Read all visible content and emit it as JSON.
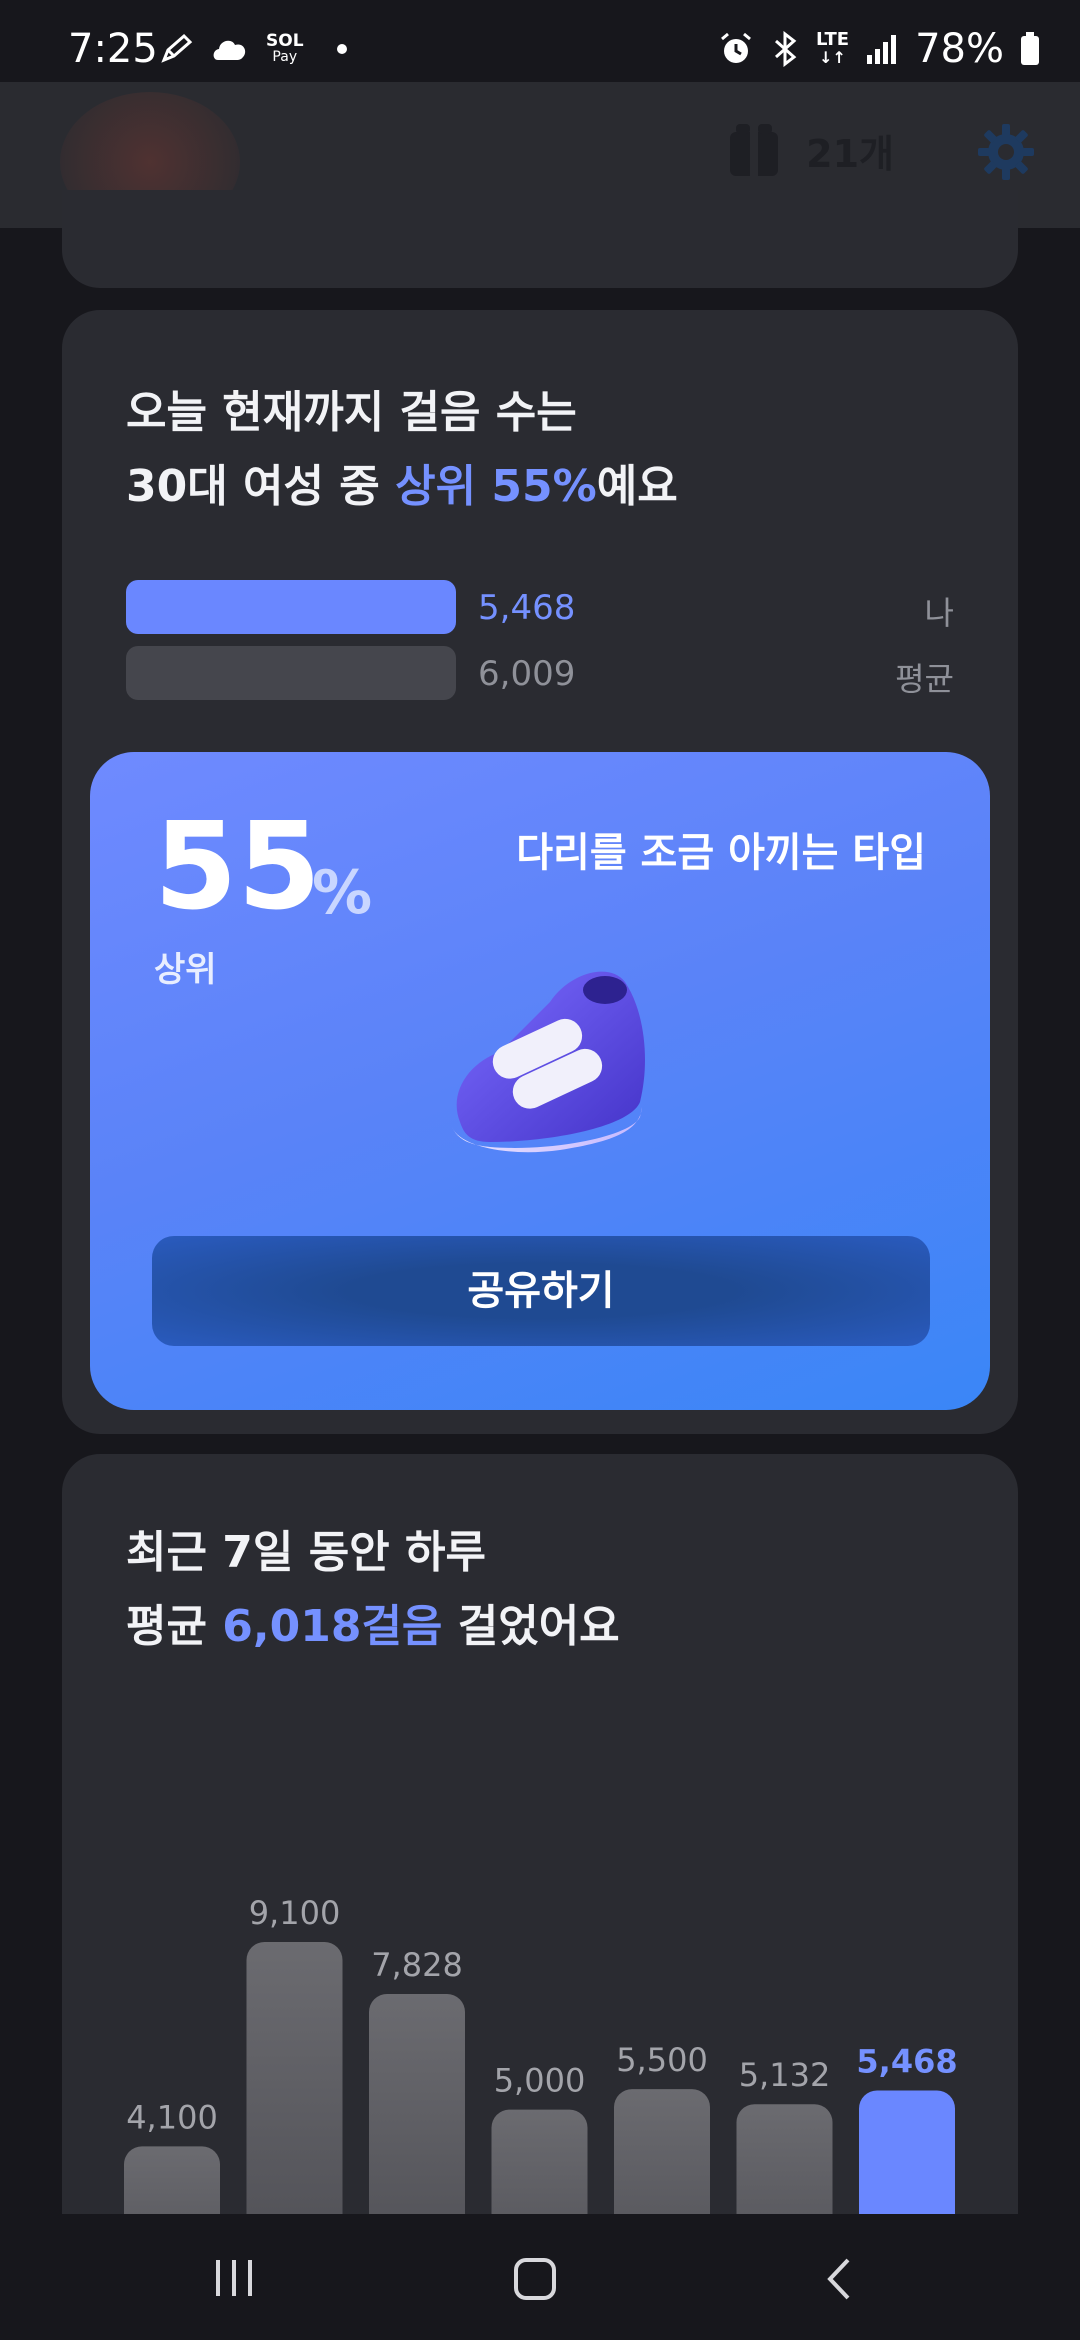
{
  "status_bar": {
    "time": "7:25",
    "left_icons": [
      "pencil-icon",
      "cloud-icon",
      "sol-pay-icon",
      "dot-icon"
    ],
    "sol_pay_top": "SOL",
    "sol_pay_bottom": "Pay",
    "network": "LTE",
    "battery": "78%"
  },
  "header": {
    "gift_count": "21개"
  },
  "card_rank": {
    "headline_line1": "오늘 현재까지 걸음 수는",
    "headline_line2_prefix": "30대 여성 중 ",
    "headline_line2_accent": "상위 55%",
    "headline_line2_suffix": "예요",
    "me": {
      "value": "5,468",
      "label": "나"
    },
    "average": {
      "value": "6,009",
      "label": "평균"
    },
    "result": {
      "number": "55",
      "unit": "%",
      "rank_label": "상위",
      "type_title": "다리를 조금 아끼는 타입",
      "share_label": "공유하기"
    }
  },
  "card_week": {
    "headline_line1": "최근 7일 동안 하루",
    "headline_line2_prefix": "평균 ",
    "headline_line2_accent": "6,018걸음",
    "headline_line2_suffix": " 걸었어요"
  },
  "chart_data": {
    "type": "bar",
    "title": "",
    "values": [
      4100,
      9100,
      7828,
      5000,
      5500,
      5132,
      5468
    ],
    "labels": [
      "4,100",
      "9,100",
      "7,828",
      "5,000",
      "5,500",
      "5,132",
      "5,468"
    ],
    "highlight_index": 6,
    "ylim": [
      0,
      9100
    ],
    "colors": {
      "bar": "#68686d",
      "highlight": "#6a87ff"
    }
  },
  "colors": {
    "accent": "#7591ff",
    "card_bg": "#2a2b31",
    "page_bg": "#17171c",
    "result_gradient_start": "#6f8aff",
    "result_gradient_end": "#3a86f7"
  },
  "nav": {
    "items": [
      "recent-apps-icon",
      "home-icon",
      "back-icon"
    ]
  }
}
